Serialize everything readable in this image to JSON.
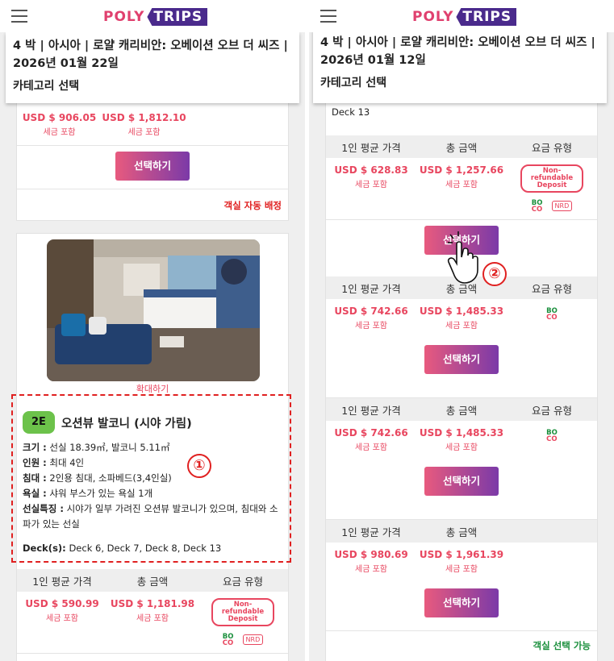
{
  "left": {
    "title": "4 박 | 아시아 | 로얄 캐리비안: 오베이션 오브 더 씨즈 | 2026년 01월 22일",
    "category": "카테고리 선택",
    "top_price_per": "USD $ 906.05",
    "top_price_total": "USD $ 1,812.10",
    "tax_label": "세금 포함",
    "select_label": "선택하기",
    "auto_assign": "객실 자동 배정",
    "enlarge": "확대하기",
    "room": {
      "code": "2E",
      "name": "오션뷰 발코니 (시야 가림)",
      "size_label": "크기 :",
      "size_value": "선실 18.39㎡, 발코니 5.11㎡",
      "people_label": "인원 :",
      "people_value": "최대 4인",
      "bed_label": "침대 :",
      "bed_value": "2인용 침대, 소파베드(3,4인실)",
      "bath_label": "욕실 :",
      "bath_value": "샤워 부스가 있는 욕실 1개",
      "feature_label": "선실특징 :",
      "feature_value": "시야가 일부 가려진 오션뷰 발코니가 있으며, 침대와 소파가 있는 선실",
      "decks_label": "Deck(s):",
      "decks_value": "Deck 6, Deck 7, Deck 8, Deck 13"
    },
    "table_headers": [
      "1인 평균 가격",
      "총 금액",
      "요금 유형"
    ],
    "row1_per": "USD $ 590.99",
    "row1_total": "USD $ 1,181.98",
    "nonref": "Non-refundable Deposit",
    "boco_top": "BO",
    "boco_bottom": "CO",
    "nrd": "NRD",
    "annotation": "①"
  },
  "right": {
    "title": "4 박 | 아시아 | 로얄 캐리비안: 오베이션 오브 더 씨즈 | 2026년 01월 12일",
    "category": "카테고리 선택",
    "deck": "Deck 13",
    "table_headers": [
      "1인 평균 가격",
      "총 금액",
      "요금 유형"
    ],
    "tax_label": "세금 포함",
    "select_label": "선택하기",
    "rows": [
      {
        "per": "USD $ 628.83",
        "total": "USD $ 1,257.66"
      },
      {
        "per": "USD $ 742.66",
        "total": "USD $ 1,485.33"
      },
      {
        "per": "USD $ 742.66",
        "total": "USD $ 1,485.33"
      },
      {
        "per": "USD $ 980.69",
        "total": "USD $ 1,961.39"
      }
    ],
    "nonref": "Non-refundable Deposit",
    "boco_top": "BO",
    "boco_bottom": "CO",
    "nrd": "NRD",
    "available": "객실 선택 가능",
    "annotation": "②"
  },
  "logo": {
    "left_text": "POLY",
    "right_text": "TRIPS"
  },
  "colors": {
    "price": "#e8465f",
    "button_from": "#e85a7e",
    "button_to": "#7b3aa8",
    "annotation": "#e02020",
    "available": "#1a8f3c"
  }
}
